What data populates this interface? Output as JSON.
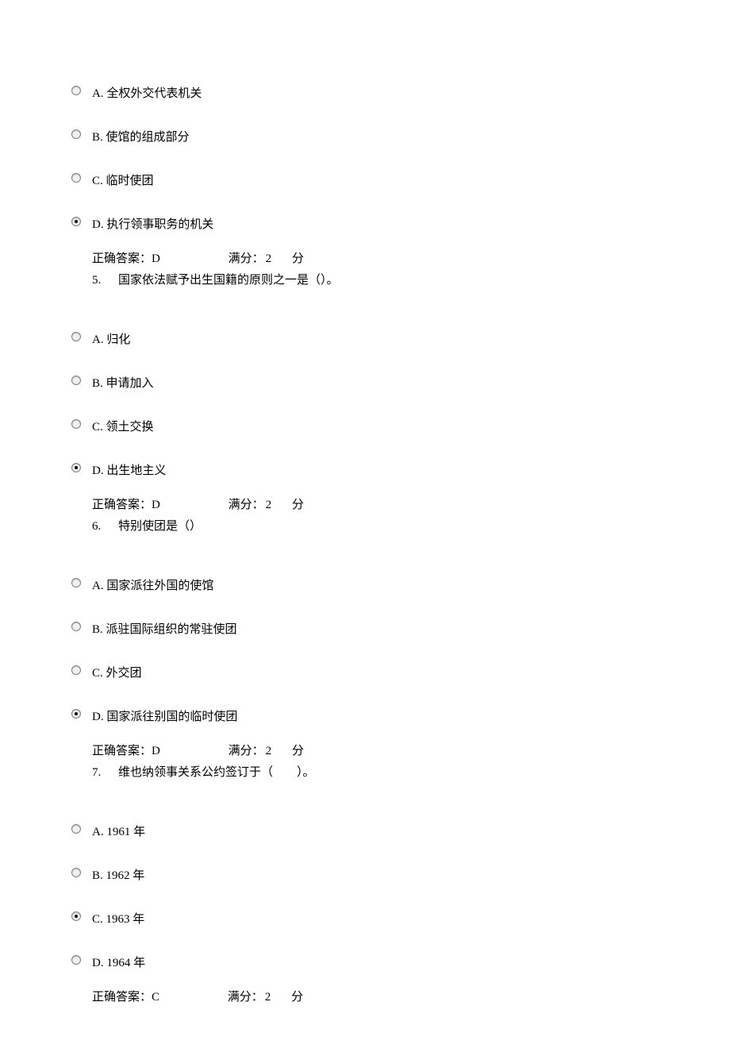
{
  "questions": [
    {
      "options": [
        {
          "label": "A. 全权外交代表机关",
          "selected": false
        },
        {
          "label": "B. 使馆的组成部分",
          "selected": false
        },
        {
          "label": "C. 临时使团",
          "selected": false
        },
        {
          "label": "D. 执行领事职务的机关",
          "selected": true
        }
      ],
      "answer_text": "正确答案：D",
      "score_label": "满分：",
      "score_value": "2",
      "score_unit": "分",
      "next_num": "5.",
      "next_text": "国家依法赋予出生国籍的原则之一是（）。"
    },
    {
      "options": [
        {
          "label": "A. 归化",
          "selected": false
        },
        {
          "label": "B. 申请加入",
          "selected": false
        },
        {
          "label": "C. 领土交换",
          "selected": false
        },
        {
          "label": "D. 出生地主义",
          "selected": true
        }
      ],
      "answer_text": "正确答案：D",
      "score_label": "满分：",
      "score_value": "2",
      "score_unit": "分",
      "next_num": "6.",
      "next_text": "特别使团是（）"
    },
    {
      "options": [
        {
          "label": "A. 国家派往外国的使馆",
          "selected": false
        },
        {
          "label": "B. 派驻国际组织的常驻使团",
          "selected": false
        },
        {
          "label": "C. 外交团",
          "selected": false
        },
        {
          "label": "D. 国家派往别国的临时使团",
          "selected": true
        }
      ],
      "answer_text": "正确答案：D",
      "score_label": "满分：",
      "score_value": "2",
      "score_unit": "分",
      "next_num": "7.",
      "next_text": "维也纳领事关系公约签订于（　　）。"
    },
    {
      "options": [
        {
          "label": "A. 1961 年",
          "selected": false
        },
        {
          "label": "B. 1962 年",
          "selected": false
        },
        {
          "label": "C. 1963 年",
          "selected": true
        },
        {
          "label": "D. 1964 年",
          "selected": false
        }
      ],
      "answer_text": "正确答案：C",
      "score_label": "满分：",
      "score_value": "2",
      "score_unit": "分",
      "next_num": "",
      "next_text": ""
    }
  ]
}
